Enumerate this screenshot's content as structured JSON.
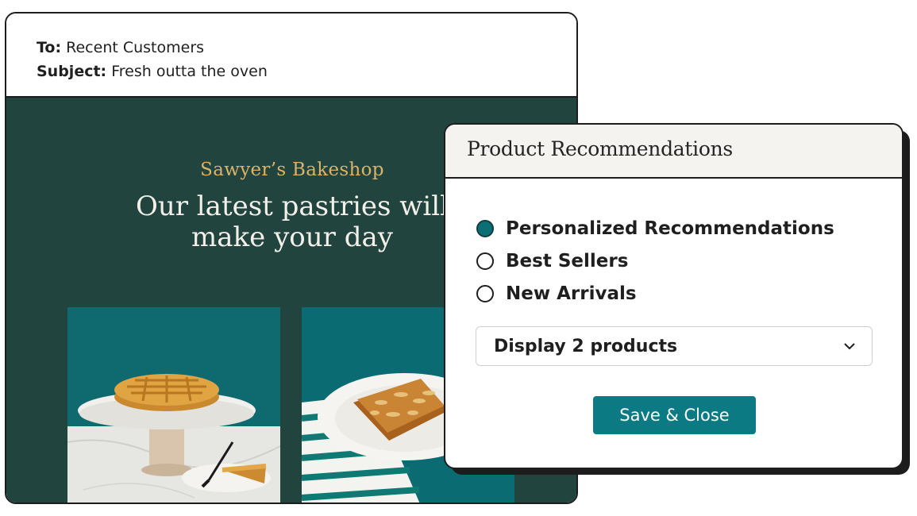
{
  "email": {
    "to_label": "To:",
    "to_value": "Recent Customers",
    "subject_label": "Subject:",
    "subject_value": "Fresh outta the oven",
    "shop_name": "Sawyer’s Bakeshop",
    "headline_line1": "Our latest pastries will",
    "headline_line2": "make your day",
    "images": [
      "pie-on-cake-stand-icon",
      "almond-pastry-on-plate-icon"
    ],
    "colors": {
      "body_bg": "#22443f",
      "shop_name": "#d8b46a",
      "headline": "#f3f0ea"
    }
  },
  "dialog": {
    "title": "Product Recommendations",
    "options": [
      {
        "label": "Personalized Recommendations",
        "selected": true
      },
      {
        "label": "Best Sellers",
        "selected": false
      },
      {
        "label": "New Arrivals",
        "selected": false
      }
    ],
    "select_value": "Display 2 products",
    "select_icon": "chevron-down-icon",
    "save_label": "Save & Close",
    "colors": {
      "accent": "#0b7a82",
      "radio_checked": "#0b6f76"
    }
  }
}
